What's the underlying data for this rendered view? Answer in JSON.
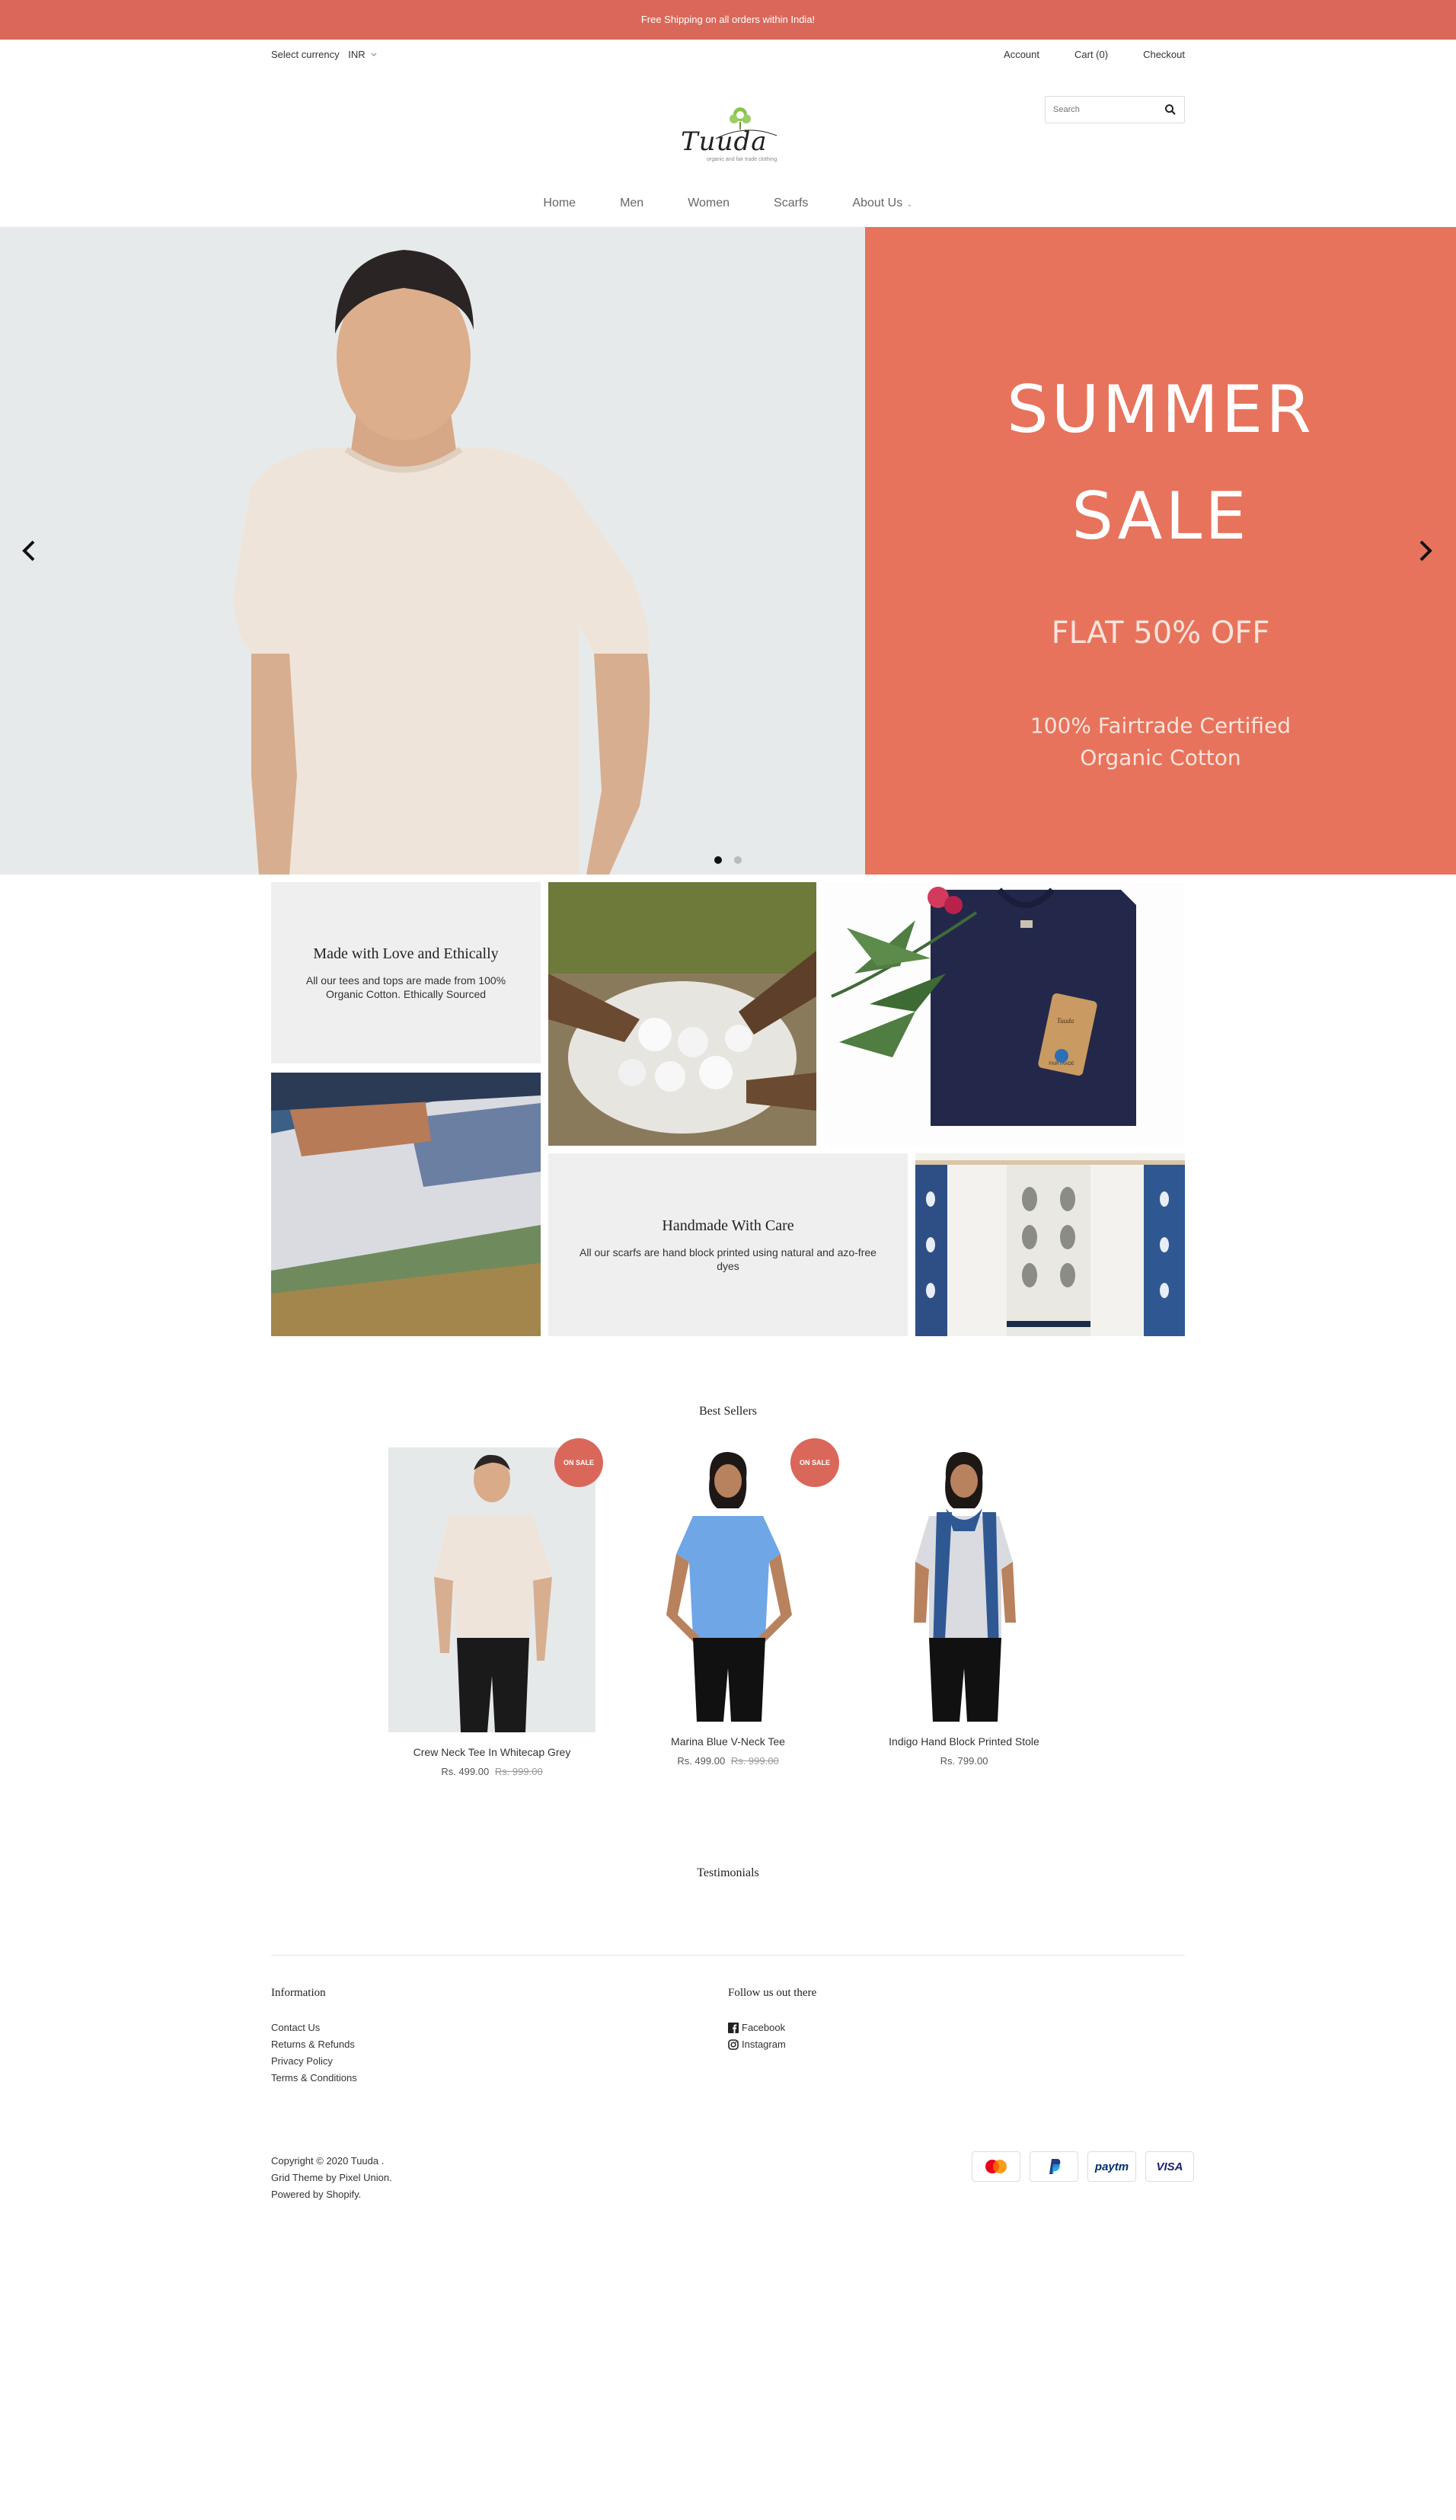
{
  "announcement": "Free Shipping on all orders within India!",
  "utility": {
    "currency_label": "Select currency",
    "currency_value": "INR",
    "links": [
      "Account",
      "Cart (0)",
      "Checkout"
    ]
  },
  "search": {
    "placeholder": "Search"
  },
  "logo": {
    "wordmark": "Tuuda",
    "tagline": "organic and fair trade clothing"
  },
  "nav": {
    "items": [
      "Home",
      "Men",
      "Women",
      "Scarfs",
      "About Us"
    ]
  },
  "hero": {
    "line1": "SUMMER",
    "line2": "SALE",
    "line3": "FLAT 50% OFF",
    "line4": "100% Fairtrade Certified",
    "line5": "Organic Cotton",
    "tag_brand": "Tuuda",
    "tag_fairtrade": "FAIRTRADE"
  },
  "features": {
    "card1": {
      "title": "Made with Love and Ethically",
      "text": "All our tees and tops are made from 100% Organic Cotton. Ethically Sourced"
    },
    "card2": {
      "title": "Handmade With Care",
      "text": "All our scarfs are hand block printed using natural and azo-free dyes"
    }
  },
  "best_sellers": {
    "title": "Best Sellers",
    "badge": "ON SALE",
    "products": [
      {
        "name": "Crew Neck Tee In Whitecap Grey",
        "price": "Rs. 499.00",
        "compare": "Rs. 999.00"
      },
      {
        "name": "Marina Blue V-Neck Tee",
        "price": "Rs. 499.00",
        "compare": "Rs. 999.00"
      },
      {
        "name": "Indigo Hand Block Printed Stole",
        "price": "Rs. 799.00",
        "compare": ""
      }
    ]
  },
  "testimonials": {
    "title": "Testimonials"
  },
  "footer": {
    "info_title": "Information",
    "info_links": [
      "Contact Us",
      "Returns & Refunds",
      "Privacy Policy",
      "Terms & Conditions"
    ],
    "follow_title": "Follow us out there",
    "social": [
      "Facebook",
      "Instagram"
    ],
    "copyright": "Copyright © 2020 Tuuda .",
    "theme": "Grid Theme by Pixel Union.",
    "powered": "Powered by Shopify.",
    "payments": [
      "mastercard-icon",
      "paypal-icon",
      "paytm-icon",
      "visa-icon"
    ],
    "payment_text": {
      "paytm": "paytm",
      "visa": "VISA"
    }
  },
  "colors": {
    "brand": "#d9685a",
    "hero_panel": "#e7735c",
    "tile_bg": "#efefef"
  }
}
